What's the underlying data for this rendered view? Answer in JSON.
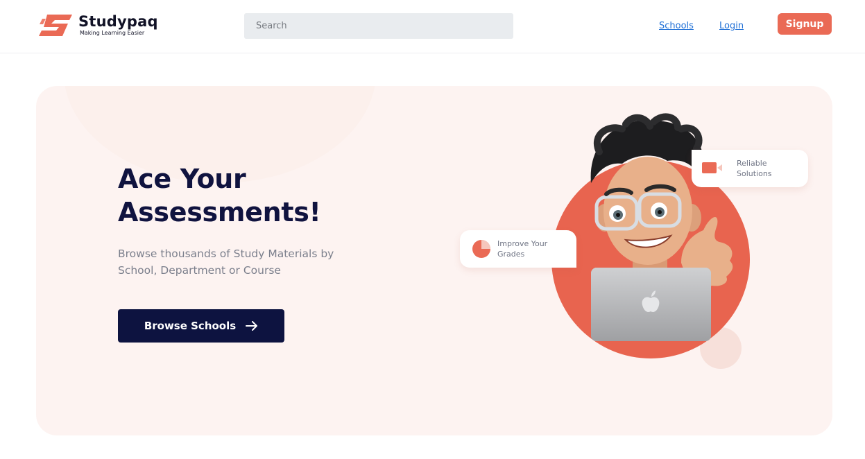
{
  "header": {
    "brand_name": "Studypaq",
    "brand_tagline": "Making Learning Easier",
    "search_placeholder": "Search",
    "nav": {
      "schools": "Schools",
      "login": "Login",
      "signup": "Signup"
    }
  },
  "hero": {
    "title": "Ace Your\nAssessments!",
    "subtitle": "Browse thousands of Study Materials by School, Department or Course",
    "cta_label": "Browse Schools",
    "cards": {
      "solutions": "Reliable\nSolutions",
      "grades": "Improve Your\nGrades"
    }
  },
  "colors": {
    "accent": "#ea6a55",
    "navy": "#0d1340",
    "hero_bg": "#fdf3f1",
    "link": "#1f6fd6"
  },
  "icons": {
    "logo": "studypaq-logo-icon",
    "cta": "arrow-right-icon",
    "solutions": "video-camera-icon",
    "grades": "pie-chart-icon"
  }
}
